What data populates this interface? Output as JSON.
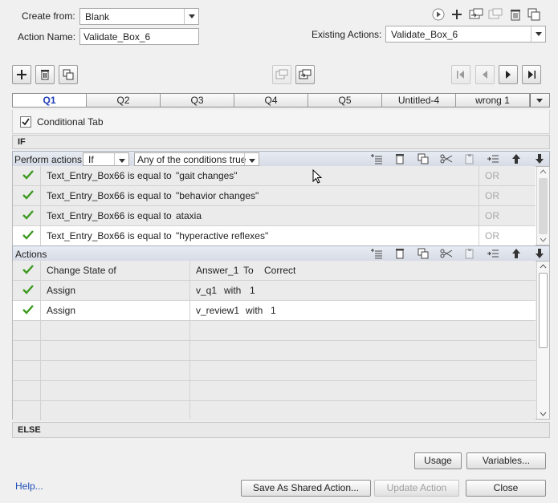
{
  "top": {
    "create_from_label": "Create from:",
    "create_from_value": "Blank",
    "action_name_label": "Action Name:",
    "action_name_value": "Validate_Box_6",
    "existing_actions_label": "Existing Actions:",
    "existing_actions_value": "Validate_Box_6"
  },
  "tabs": [
    "Q1",
    "Q2",
    "Q3",
    "Q4",
    "Q5",
    "Untitled-4",
    "wrong 1"
  ],
  "conditional_tab_label": "Conditional Tab",
  "if_label": "IF",
  "perform": {
    "label": "Perform actions:",
    "mode": "If",
    "condition": "Any of the conditions true"
  },
  "conditions": [
    {
      "variable": "Text_Entry_Box66",
      "operator": "is equal to",
      "value": "\"gait changes\"",
      "join": "OR"
    },
    {
      "variable": "Text_Entry_Box66",
      "operator": "is equal to",
      "value": "\"behavior changes\"",
      "join": "OR"
    },
    {
      "variable": "Text_Entry_Box66",
      "operator": "is equal to",
      "value": "ataxia",
      "join": "OR"
    },
    {
      "variable": "Text_Entry_Box66",
      "operator": "is equal to",
      "value": "\"hyperactive reflexes\"",
      "join": "OR"
    }
  ],
  "actions_label": "Actions",
  "actions": [
    {
      "action": "Change State of",
      "target": "Answer_1",
      "mid": "To",
      "value": "Correct"
    },
    {
      "action": "Assign",
      "target": "v_q1",
      "mid": "with",
      "value": "1"
    },
    {
      "action": "Assign",
      "target": "v_review1",
      "mid": "with",
      "value": "1"
    }
  ],
  "else_label": "ELSE",
  "buttons": {
    "usage": "Usage",
    "variables": "Variables...",
    "help": "Help...",
    "save_shared": "Save As Shared Action...",
    "update": "Update Action",
    "close": "Close"
  },
  "colors": {
    "tab_active": "#1f3fb4",
    "check": "#3d9a1f",
    "link": "#1f4fb8"
  }
}
